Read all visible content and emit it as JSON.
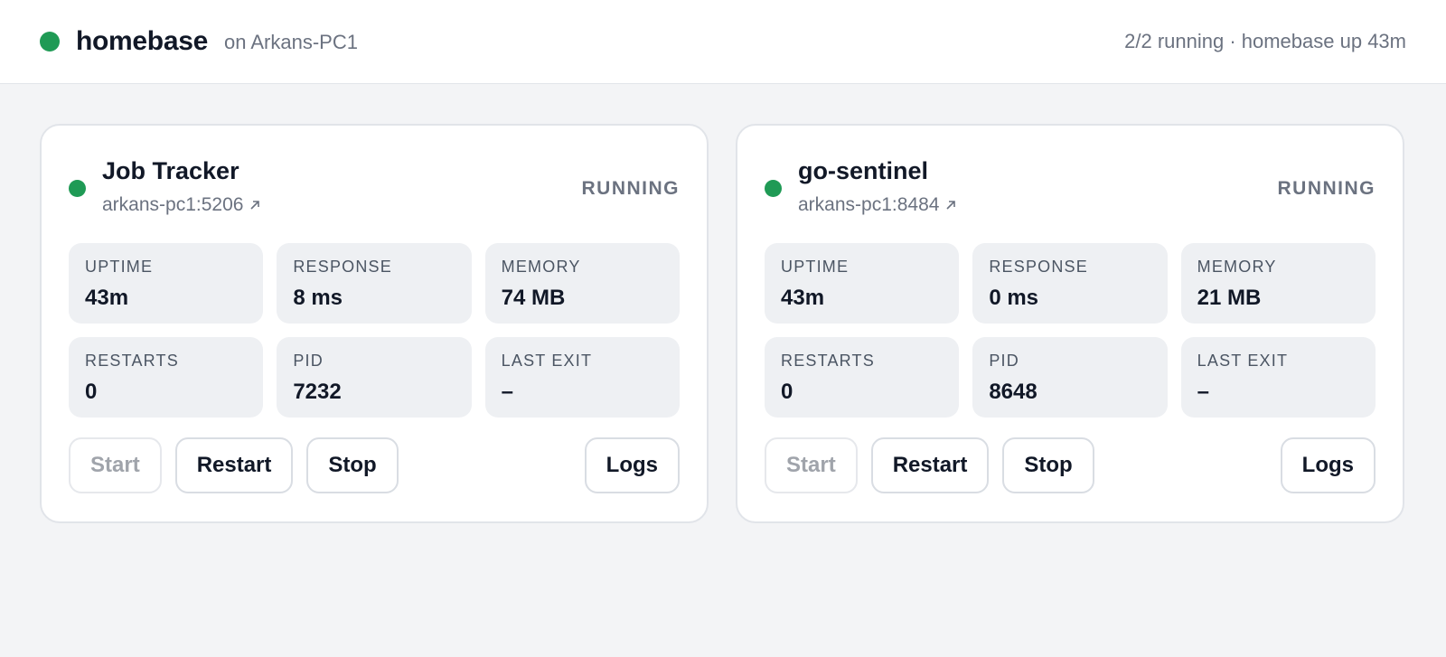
{
  "header": {
    "app_name": "homebase",
    "host_text": "on Arkans-PC1",
    "summary": "2/2 running · homebase up 43m",
    "status_color": "#1f9a55"
  },
  "services": [
    {
      "title": "Job Tracker",
      "link": "arkans-pc1:5206",
      "status": "RUNNING",
      "stats": [
        {
          "label": "UPTIME",
          "value": "43m"
        },
        {
          "label": "RESPONSE",
          "value": "8 ms"
        },
        {
          "label": "MEMORY",
          "value": "74 MB"
        },
        {
          "label": "RESTARTS",
          "value": "0"
        },
        {
          "label": "PID",
          "value": "7232"
        },
        {
          "label": "LAST EXIT",
          "value": "–"
        }
      ],
      "actions": {
        "start": "Start",
        "restart": "Restart",
        "stop": "Stop",
        "logs": "Logs"
      }
    },
    {
      "title": "go-sentinel",
      "link": "arkans-pc1:8484",
      "status": "RUNNING",
      "stats": [
        {
          "label": "UPTIME",
          "value": "43m"
        },
        {
          "label": "RESPONSE",
          "value": "0 ms"
        },
        {
          "label": "MEMORY",
          "value": "21 MB"
        },
        {
          "label": "RESTARTS",
          "value": "0"
        },
        {
          "label": "PID",
          "value": "8648"
        },
        {
          "label": "LAST EXIT",
          "value": "–"
        }
      ],
      "actions": {
        "start": "Start",
        "restart": "Restart",
        "stop": "Stop",
        "logs": "Logs"
      }
    }
  ]
}
